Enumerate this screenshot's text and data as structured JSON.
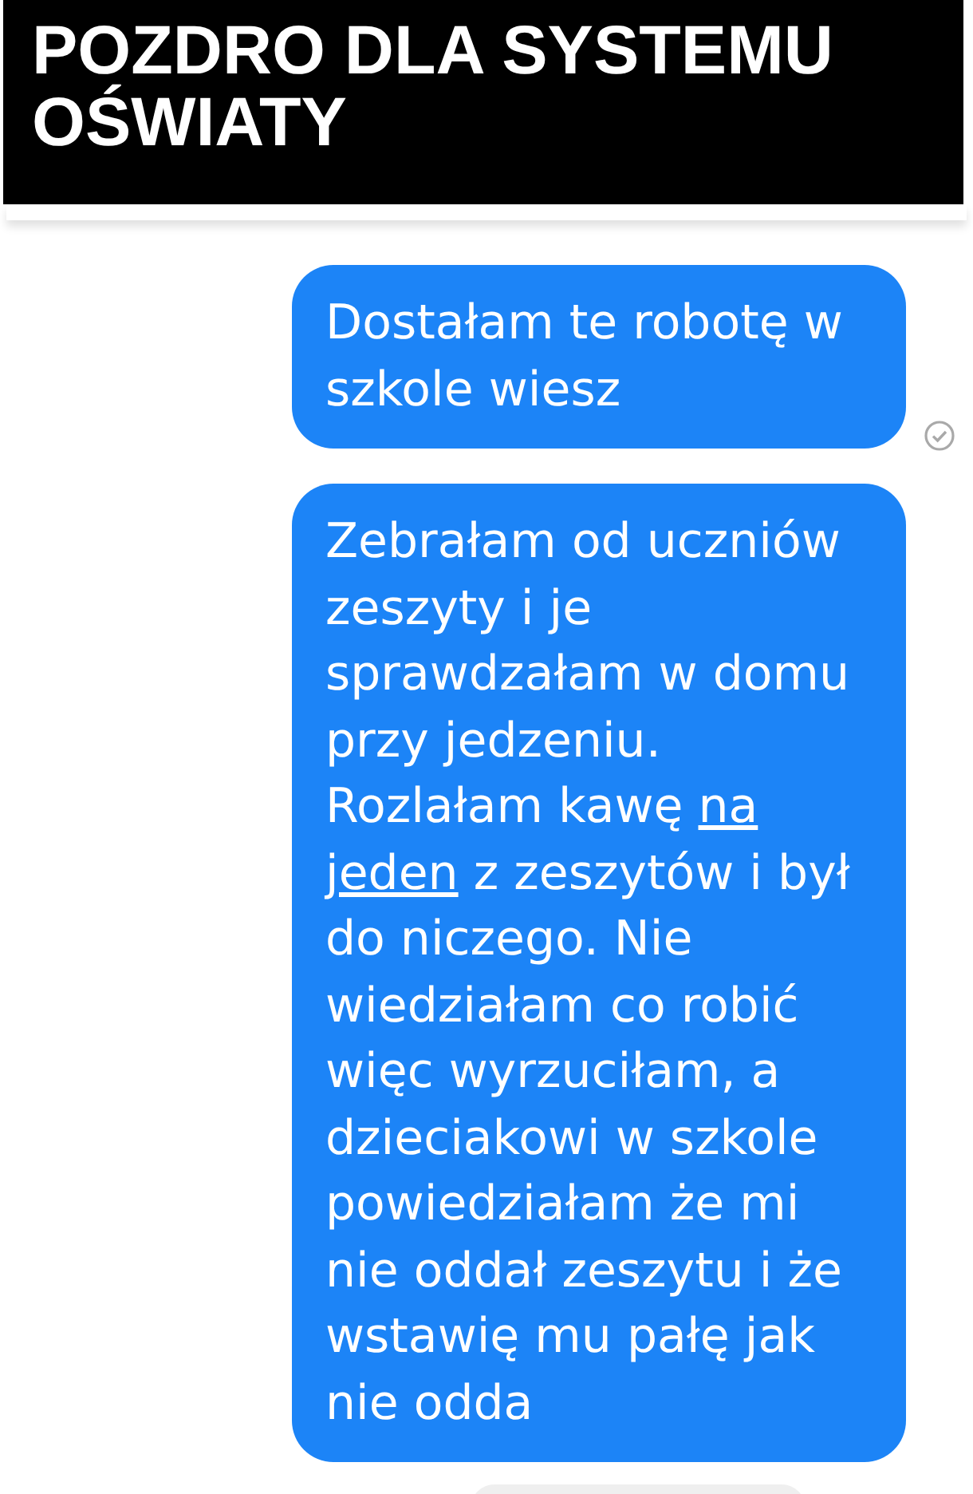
{
  "title": "POZDRO DLA SYSTEMU OŚWIATY",
  "messages": [
    {
      "seen": true,
      "segments": [
        {
          "text": "Dostałam te robotę w szkole wiesz",
          "underline": false
        }
      ]
    },
    {
      "seen": false,
      "segments": [
        {
          "text": "Zebrałam od uczniów zeszyty i je sprawdzałam w domu przy jedzeniu. Rozlałam kawę ",
          "underline": false
        },
        {
          "text": "na jeden",
          "underline": true
        },
        {
          "text": " z zeszytów i był do niczego. Nie wiedziałam co robić więc wyrzuciłam, a dzieciakowi w szkole powiedziałam że mi nie oddał zeszytu i że wstawię mu pałę jak nie odda",
          "underline": false
        }
      ]
    }
  ]
}
